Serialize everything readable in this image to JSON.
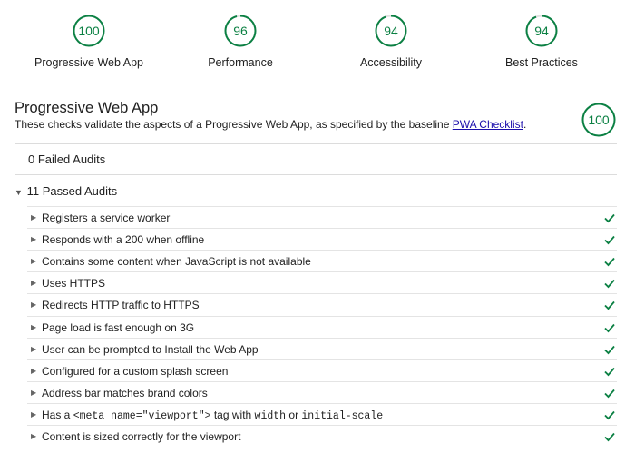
{
  "summary": [
    {
      "score": "100",
      "label": "Progressive Web App"
    },
    {
      "score": "96",
      "label": "Performance"
    },
    {
      "score": "94",
      "label": "Accessibility"
    },
    {
      "score": "94",
      "label": "Best Practices"
    }
  ],
  "section": {
    "title": "Progressive Web App",
    "desc_prefix": "These checks validate the aspects of a Progressive Web App, as specified by the baseline ",
    "desc_link": "PWA Checklist",
    "desc_suffix": ".",
    "score": "100"
  },
  "failed_label": "0 Failed Audits",
  "passed_label": "11 Passed Audits",
  "audits": [
    "Registers a service worker",
    "Responds with a 200 when offline",
    "Contains some content when JavaScript is not available",
    "Uses HTTPS",
    "Redirects HTTP traffic to HTTPS",
    "Page load is fast enough on 3G",
    "User can be prompted to Install the Web App",
    "Configured for a custom splash screen",
    "Address bar matches brand colors",
    "Has a <meta name=\"viewport\"> tag with width or initial-scale",
    "Content is sized correctly for the viewport"
  ],
  "viewport_audit": {
    "pre": "Has a ",
    "code1": "<meta name=\"viewport\">",
    "mid": " tag with ",
    "code2": "width",
    "or": " or ",
    "code3": "initial-scale"
  },
  "colors": {
    "pass": "#0b8043"
  }
}
